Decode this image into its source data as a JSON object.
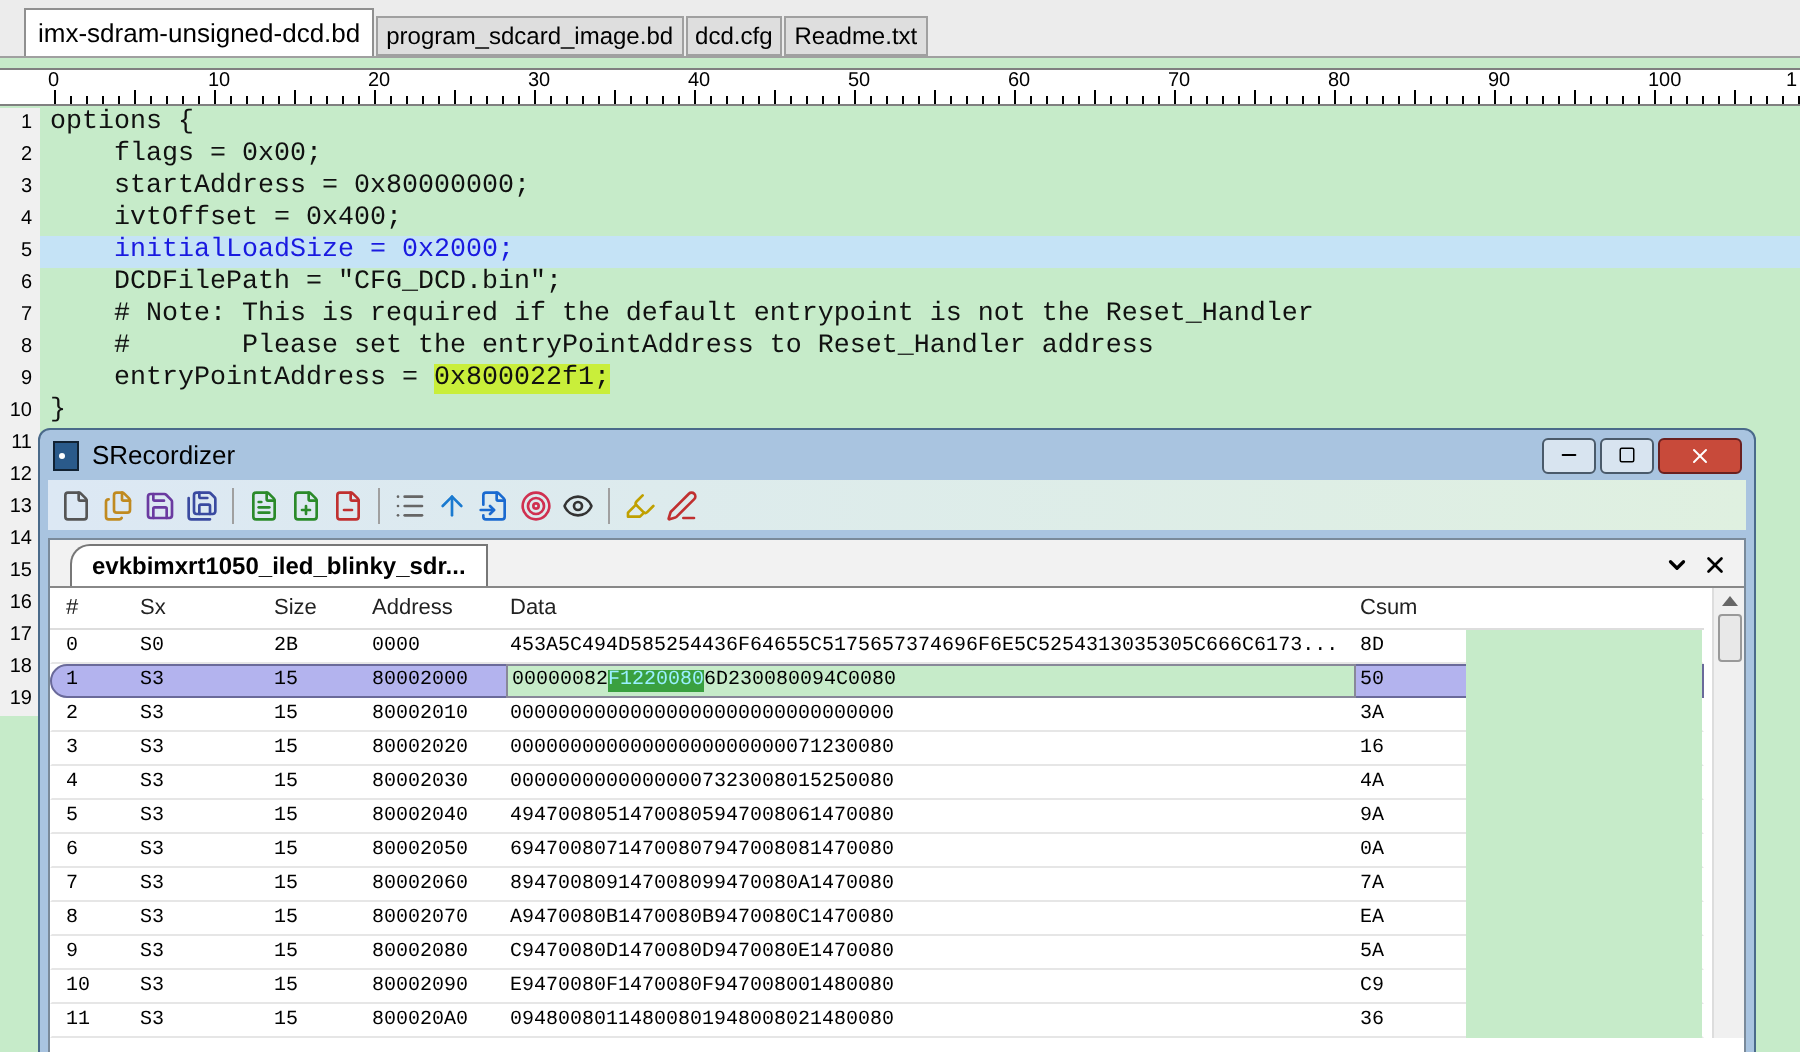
{
  "editor_tabs": [
    {
      "label": "imx-sdram-unsigned-dcd.bd",
      "selected": true
    },
    {
      "label": "program_sdcard_image.bd",
      "selected": false
    },
    {
      "label": "dcd.cfg",
      "selected": false
    },
    {
      "label": "Readme.txt",
      "selected": false
    }
  ],
  "ruler": {
    "labels": [
      "0",
      "10",
      "20",
      "30",
      "40",
      "50",
      "60",
      "70",
      "80",
      "90",
      "100",
      "1"
    ]
  },
  "code_lines": [
    {
      "number": "1",
      "current": false,
      "segments": [
        {
          "text": "options {",
          "highlight": false
        }
      ]
    },
    {
      "number": "2",
      "current": false,
      "segments": [
        {
          "text": "    flags = 0x00;",
          "highlight": false
        }
      ]
    },
    {
      "number": "3",
      "current": false,
      "segments": [
        {
          "text": "    startAddress = 0x80000000;",
          "highlight": false
        }
      ]
    },
    {
      "number": "4",
      "current": false,
      "segments": [
        {
          "text": "    ivtOffset = 0x400;",
          "highlight": false
        }
      ]
    },
    {
      "number": "5",
      "current": true,
      "segments": [
        {
          "text": "    initialLoadSize = 0x2000;",
          "highlight": false
        }
      ]
    },
    {
      "number": "6",
      "current": false,
      "segments": [
        {
          "text": "    DCDFilePath = \"CFG_DCD.bin\";",
          "highlight": false
        }
      ]
    },
    {
      "number": "7",
      "current": false,
      "segments": [
        {
          "text": "    # Note: This is required if the default entrypoint is not the Reset_Handler",
          "highlight": false
        }
      ]
    },
    {
      "number": "8",
      "current": false,
      "segments": [
        {
          "text": "    #       Please set the entryPointAddress to Reset_Handler address",
          "highlight": false
        }
      ]
    },
    {
      "number": "9",
      "current": false,
      "segments": [
        {
          "text": "    entryPointAddress = ",
          "highlight": false
        },
        {
          "text": "0x800022f1;",
          "highlight": true
        }
      ]
    },
    {
      "number": "10",
      "current": false,
      "segments": [
        {
          "text": "}",
          "highlight": false
        }
      ]
    },
    {
      "number": "11",
      "current": false
    },
    {
      "number": "12",
      "current": false
    },
    {
      "number": "13",
      "current": false
    },
    {
      "number": "14",
      "current": false
    },
    {
      "number": "15",
      "current": false
    },
    {
      "number": "16",
      "current": false
    },
    {
      "number": "17",
      "current": false
    },
    {
      "number": "18",
      "current": false
    },
    {
      "number": "19",
      "current": false
    }
  ],
  "window": {
    "title": "SRecordizer",
    "doc_tab": {
      "label": "evkbimxrt1050_iled_blinky_sdr...",
      "selected": true
    },
    "table": {
      "columns": [
        "#",
        "Sx",
        "Size",
        "Address",
        "Data",
        "Csum"
      ],
      "rows": [
        {
          "index": "0",
          "sx": "S0",
          "size": "2B",
          "address": "0000",
          "data": [
            {
              "text": "453A5C494D585254436F64655C5175657374696F6E5C5254313035305C666C6173...",
              "selected": false
            }
          ],
          "csum": "8D",
          "selected": false
        },
        {
          "index": "1",
          "sx": "S3",
          "size": "15",
          "address": "80002000",
          "data": [
            {
              "text": "00000082",
              "selected": false
            },
            {
              "text": "F1220080",
              "selected": true
            },
            {
              "text": "6D230080094C0080",
              "selected": false
            }
          ],
          "csum": "50",
          "selected": true
        },
        {
          "index": "2",
          "sx": "S3",
          "size": "15",
          "address": "80002010",
          "data": [
            {
              "text": "00000000000000000000000000000000",
              "selected": false
            }
          ],
          "csum": "3A",
          "selected": false
        },
        {
          "index": "3",
          "sx": "S3",
          "size": "15",
          "address": "80002020",
          "data": [
            {
              "text": "00000000000000000000000071230080",
              "selected": false
            }
          ],
          "csum": "16",
          "selected": false
        },
        {
          "index": "4",
          "sx": "S3",
          "size": "15",
          "address": "80002030",
          "data": [
            {
              "text": "00000000000000007323008015250080",
              "selected": false
            }
          ],
          "csum": "4A",
          "selected": false
        },
        {
          "index": "5",
          "sx": "S3",
          "size": "15",
          "address": "80002040",
          "data": [
            {
              "text": "49470080514700805947008061470080",
              "selected": false
            }
          ],
          "csum": "9A",
          "selected": false
        },
        {
          "index": "6",
          "sx": "S3",
          "size": "15",
          "address": "80002050",
          "data": [
            {
              "text": "69470080714700807947008081470080",
              "selected": false
            }
          ],
          "csum": "0A",
          "selected": false
        },
        {
          "index": "7",
          "sx": "S3",
          "size": "15",
          "address": "80002060",
          "data": [
            {
              "text": "894700809147008099470080A1470080",
              "selected": false
            }
          ],
          "csum": "7A",
          "selected": false
        },
        {
          "index": "8",
          "sx": "S3",
          "size": "15",
          "address": "80002070",
          "data": [
            {
              "text": "A9470080B1470080B9470080C1470080",
              "selected": false
            }
          ],
          "csum": "EA",
          "selected": false
        },
        {
          "index": "9",
          "sx": "S3",
          "size": "15",
          "address": "80002080",
          "data": [
            {
              "text": "C9470080D1470080D9470080E1470080",
              "selected": false
            }
          ],
          "csum": "5A",
          "selected": false
        },
        {
          "index": "10",
          "sx": "S3",
          "size": "15",
          "address": "80002090",
          "data": [
            {
              "text": "E9470080F1470080F947008001480080",
              "selected": false
            }
          ],
          "csum": "C9",
          "selected": false
        },
        {
          "index": "11",
          "sx": "S3",
          "size": "15",
          "address": "800020A0",
          "data": [
            {
              "text": "09480080114800801948008021480080",
              "selected": false
            }
          ],
          "csum": "36",
          "selected": false
        }
      ]
    }
  }
}
